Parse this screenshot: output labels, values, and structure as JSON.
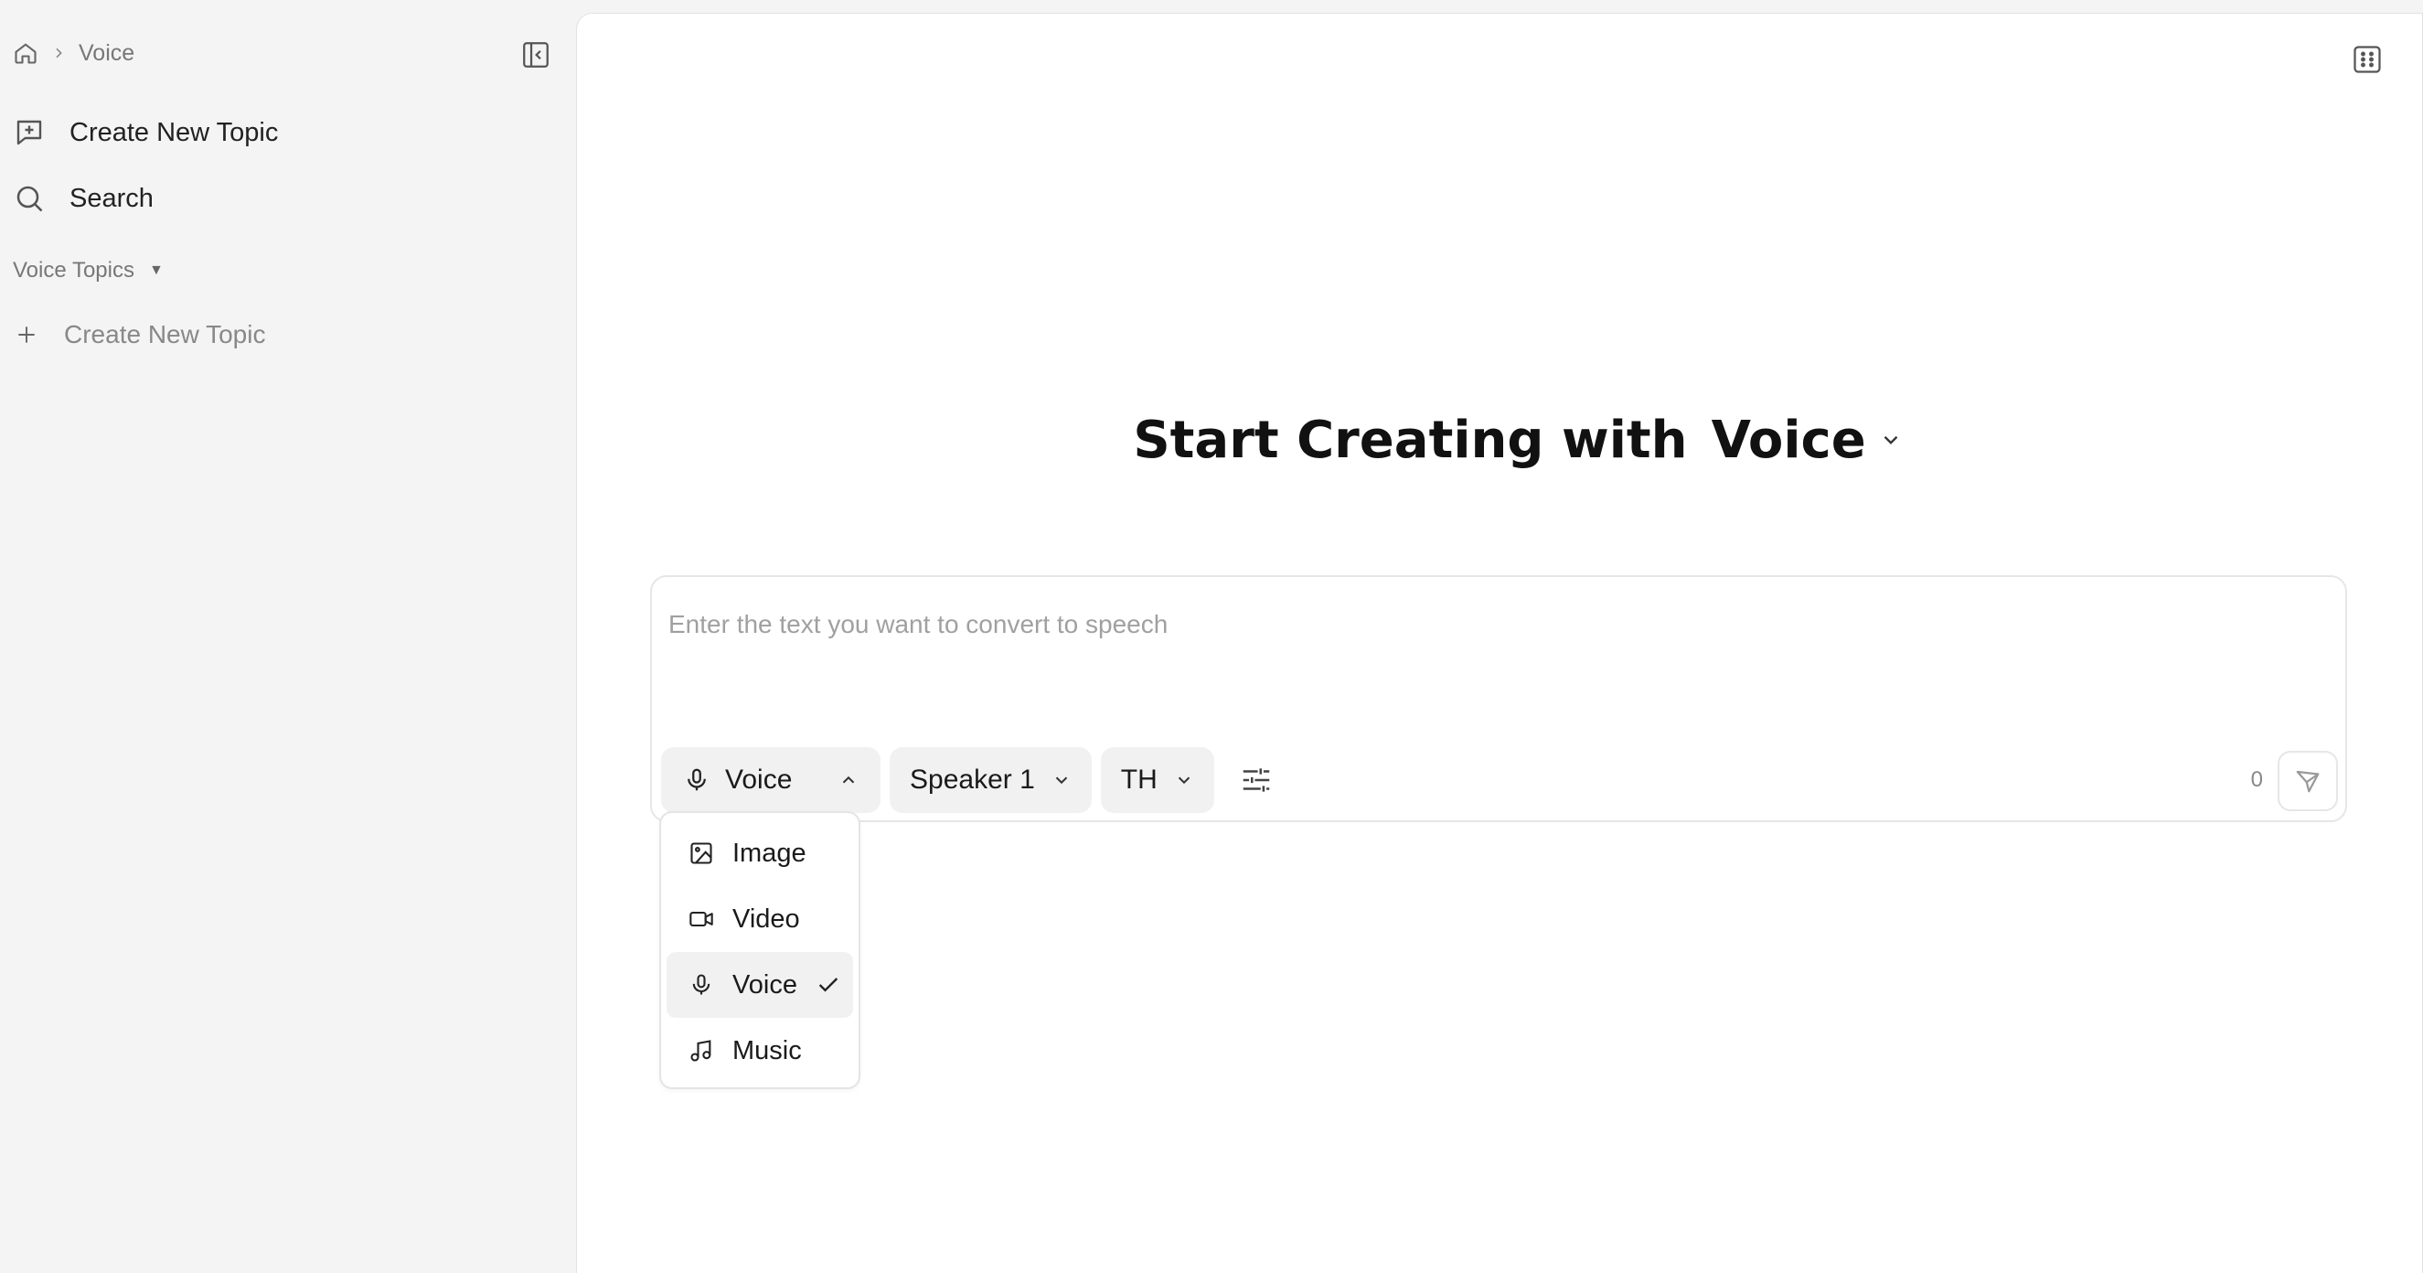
{
  "breadcrumb": {
    "current": "Voice"
  },
  "sidebar": {
    "create_topic": "Create New Topic",
    "search": "Search",
    "section_title": "Voice Topics",
    "section_caret": "▼",
    "add_topic": "Create New Topic"
  },
  "main": {
    "heading_prefix": "Start Creating with",
    "heading_mode": "Voice",
    "input_placeholder": "Enter the text you want to convert to speech",
    "toolbar": {
      "mode": "Voice",
      "speaker": "Speaker 1",
      "language": "TH"
    },
    "char_count": "0"
  },
  "dropdown": {
    "items": [
      {
        "label": "Image",
        "icon": "image-icon",
        "selected": false
      },
      {
        "label": "Video",
        "icon": "video-icon",
        "selected": false
      },
      {
        "label": "Voice",
        "icon": "mic-icon",
        "selected": true
      },
      {
        "label": "Music",
        "icon": "music-icon",
        "selected": false
      }
    ]
  }
}
